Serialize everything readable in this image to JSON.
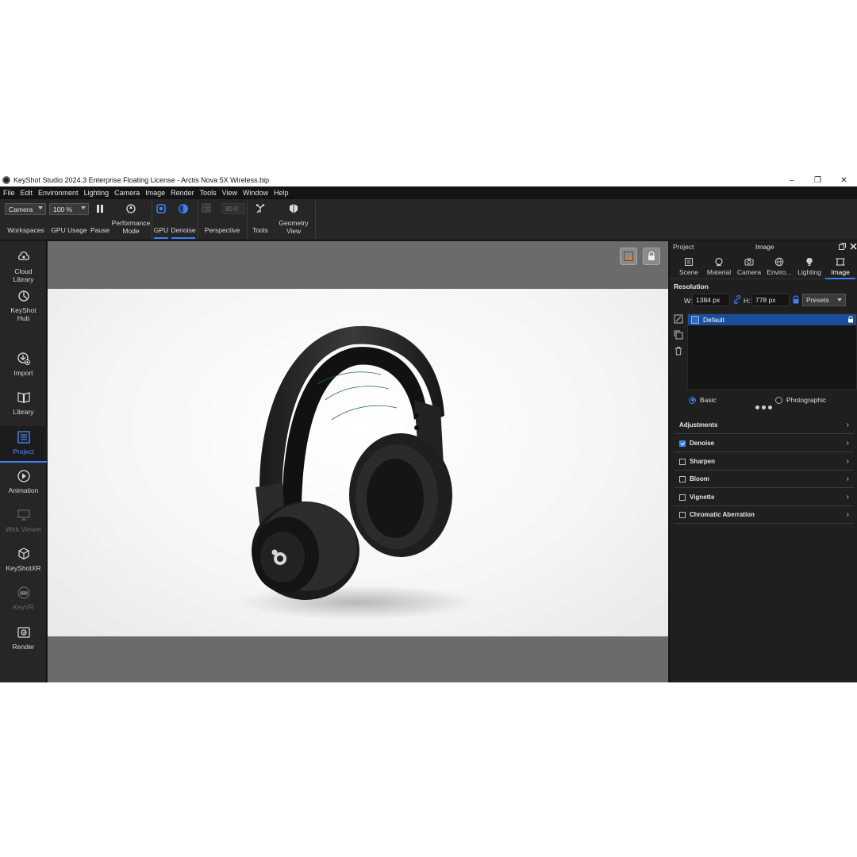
{
  "window": {
    "title": "KeyShot Studio 2024.3 Enterprise Floating License  - Arctis Nova 5X Wireless.bip",
    "controls": [
      "–",
      "❐",
      "✕"
    ]
  },
  "menu": [
    "File",
    "Edit",
    "Environment",
    "Lighting",
    "Camera",
    "Image",
    "Render",
    "Tools",
    "View",
    "Window",
    "Help"
  ],
  "toolbar": {
    "camera_select": "Camera",
    "zoom_select": "100 %",
    "workspaces": "Workspaces",
    "gpu_usage": "GPU Usage",
    "pause": "Pause",
    "performance_mode": "Performance Mode",
    "gpu": "GPU",
    "denoise": "Denoise",
    "fov_value": "80.0",
    "perspective": "Perspective",
    "tools": "Tools",
    "geometry_view": "Geometry View"
  },
  "sidebar": {
    "cloud_library": "Cloud Library",
    "keyshot_hub": "KeyShot Hub",
    "import": "Import",
    "library": "Library",
    "project": "Project",
    "animation": "Animation",
    "web_viewer": "Web Viewer",
    "keyshotxr": "KeyShotXR",
    "keyvr": "KeyVR",
    "render": "Render"
  },
  "panel": {
    "project_label": "Project",
    "image_label": "Image",
    "tabs": [
      "Scene",
      "Material",
      "Camera",
      "Enviro...",
      "Lighting",
      "Image"
    ],
    "resolution": {
      "title": "Resolution",
      "w_label": "W:",
      "w_value": "1384 px",
      "h_label": "H:",
      "h_value": "778 px",
      "presets": "Presets"
    },
    "preset_item": "Default",
    "mode_basic": "Basic",
    "mode_photographic": "Photographic",
    "sections": {
      "adjustments": "Adjustments",
      "denoise": "Denoise",
      "sharpen": "Sharpen",
      "bloom": "Bloom",
      "vignette": "Vignette",
      "chromatic_aberration": "Chromatic Aberration"
    }
  },
  "colors": {
    "accent": "#3b82f6",
    "panel_bg": "#1f1f1f",
    "viewport_bg": "#6b6b6b"
  }
}
